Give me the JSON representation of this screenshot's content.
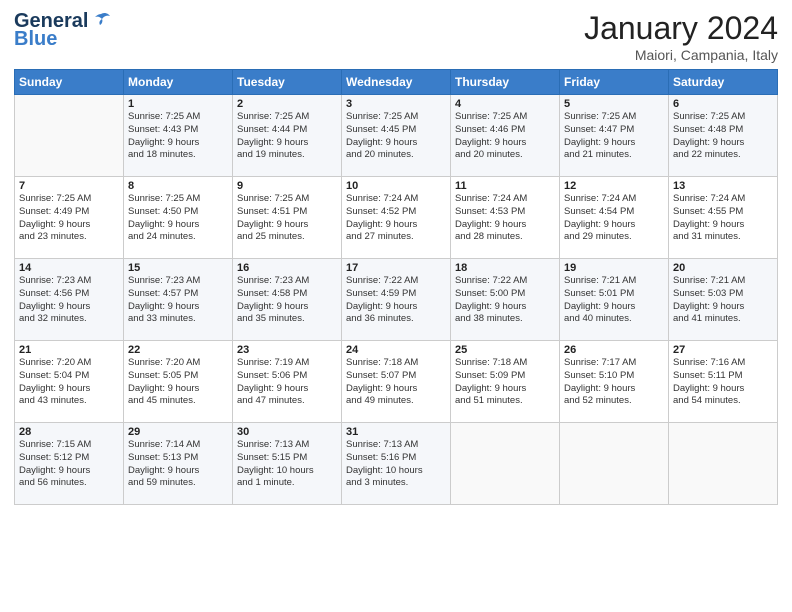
{
  "header": {
    "logo_general": "General",
    "logo_blue": "Blue",
    "title": "January 2024",
    "subtitle": "Maiori, Campania, Italy"
  },
  "days_of_week": [
    "Sunday",
    "Monday",
    "Tuesday",
    "Wednesday",
    "Thursday",
    "Friday",
    "Saturday"
  ],
  "weeks": [
    [
      {
        "day": "",
        "content": ""
      },
      {
        "day": "1",
        "content": "Sunrise: 7:25 AM\nSunset: 4:43 PM\nDaylight: 9 hours\nand 18 minutes."
      },
      {
        "day": "2",
        "content": "Sunrise: 7:25 AM\nSunset: 4:44 PM\nDaylight: 9 hours\nand 19 minutes."
      },
      {
        "day": "3",
        "content": "Sunrise: 7:25 AM\nSunset: 4:45 PM\nDaylight: 9 hours\nand 20 minutes."
      },
      {
        "day": "4",
        "content": "Sunrise: 7:25 AM\nSunset: 4:46 PM\nDaylight: 9 hours\nand 20 minutes."
      },
      {
        "day": "5",
        "content": "Sunrise: 7:25 AM\nSunset: 4:47 PM\nDaylight: 9 hours\nand 21 minutes."
      },
      {
        "day": "6",
        "content": "Sunrise: 7:25 AM\nSunset: 4:48 PM\nDaylight: 9 hours\nand 22 minutes."
      }
    ],
    [
      {
        "day": "7",
        "content": "Sunrise: 7:25 AM\nSunset: 4:49 PM\nDaylight: 9 hours\nand 23 minutes."
      },
      {
        "day": "8",
        "content": "Sunrise: 7:25 AM\nSunset: 4:50 PM\nDaylight: 9 hours\nand 24 minutes."
      },
      {
        "day": "9",
        "content": "Sunrise: 7:25 AM\nSunset: 4:51 PM\nDaylight: 9 hours\nand 25 minutes."
      },
      {
        "day": "10",
        "content": "Sunrise: 7:24 AM\nSunset: 4:52 PM\nDaylight: 9 hours\nand 27 minutes."
      },
      {
        "day": "11",
        "content": "Sunrise: 7:24 AM\nSunset: 4:53 PM\nDaylight: 9 hours\nand 28 minutes."
      },
      {
        "day": "12",
        "content": "Sunrise: 7:24 AM\nSunset: 4:54 PM\nDaylight: 9 hours\nand 29 minutes."
      },
      {
        "day": "13",
        "content": "Sunrise: 7:24 AM\nSunset: 4:55 PM\nDaylight: 9 hours\nand 31 minutes."
      }
    ],
    [
      {
        "day": "14",
        "content": "Sunrise: 7:23 AM\nSunset: 4:56 PM\nDaylight: 9 hours\nand 32 minutes."
      },
      {
        "day": "15",
        "content": "Sunrise: 7:23 AM\nSunset: 4:57 PM\nDaylight: 9 hours\nand 33 minutes."
      },
      {
        "day": "16",
        "content": "Sunrise: 7:23 AM\nSunset: 4:58 PM\nDaylight: 9 hours\nand 35 minutes."
      },
      {
        "day": "17",
        "content": "Sunrise: 7:22 AM\nSunset: 4:59 PM\nDaylight: 9 hours\nand 36 minutes."
      },
      {
        "day": "18",
        "content": "Sunrise: 7:22 AM\nSunset: 5:00 PM\nDaylight: 9 hours\nand 38 minutes."
      },
      {
        "day": "19",
        "content": "Sunrise: 7:21 AM\nSunset: 5:01 PM\nDaylight: 9 hours\nand 40 minutes."
      },
      {
        "day": "20",
        "content": "Sunrise: 7:21 AM\nSunset: 5:03 PM\nDaylight: 9 hours\nand 41 minutes."
      }
    ],
    [
      {
        "day": "21",
        "content": "Sunrise: 7:20 AM\nSunset: 5:04 PM\nDaylight: 9 hours\nand 43 minutes."
      },
      {
        "day": "22",
        "content": "Sunrise: 7:20 AM\nSunset: 5:05 PM\nDaylight: 9 hours\nand 45 minutes."
      },
      {
        "day": "23",
        "content": "Sunrise: 7:19 AM\nSunset: 5:06 PM\nDaylight: 9 hours\nand 47 minutes."
      },
      {
        "day": "24",
        "content": "Sunrise: 7:18 AM\nSunset: 5:07 PM\nDaylight: 9 hours\nand 49 minutes."
      },
      {
        "day": "25",
        "content": "Sunrise: 7:18 AM\nSunset: 5:09 PM\nDaylight: 9 hours\nand 51 minutes."
      },
      {
        "day": "26",
        "content": "Sunrise: 7:17 AM\nSunset: 5:10 PM\nDaylight: 9 hours\nand 52 minutes."
      },
      {
        "day": "27",
        "content": "Sunrise: 7:16 AM\nSunset: 5:11 PM\nDaylight: 9 hours\nand 54 minutes."
      }
    ],
    [
      {
        "day": "28",
        "content": "Sunrise: 7:15 AM\nSunset: 5:12 PM\nDaylight: 9 hours\nand 56 minutes."
      },
      {
        "day": "29",
        "content": "Sunrise: 7:14 AM\nSunset: 5:13 PM\nDaylight: 9 hours\nand 59 minutes."
      },
      {
        "day": "30",
        "content": "Sunrise: 7:13 AM\nSunset: 5:15 PM\nDaylight: 10 hours\nand 1 minute."
      },
      {
        "day": "31",
        "content": "Sunrise: 7:13 AM\nSunset: 5:16 PM\nDaylight: 10 hours\nand 3 minutes."
      },
      {
        "day": "",
        "content": ""
      },
      {
        "day": "",
        "content": ""
      },
      {
        "day": "",
        "content": ""
      }
    ]
  ]
}
